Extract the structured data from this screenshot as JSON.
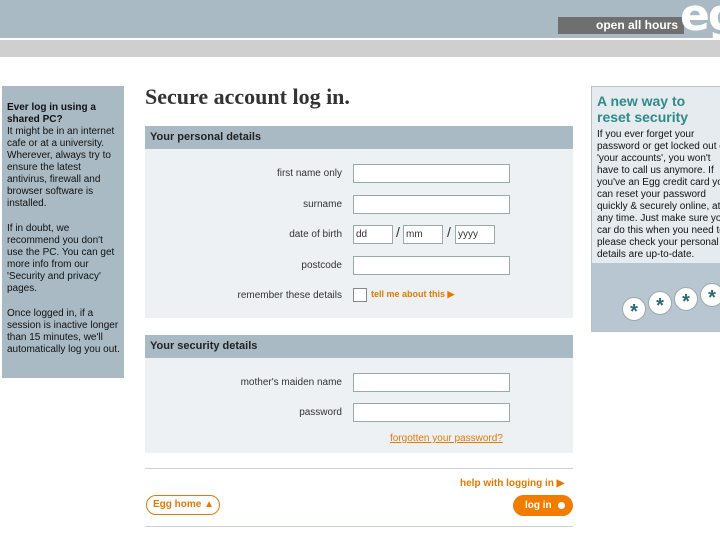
{
  "header": {
    "hours_label": "open all hours",
    "brand": "eg"
  },
  "sidebar_info": {
    "heading": "Ever log in using a shared PC?",
    "p1": "It might be in an internet cafe or at a university. Wherever, always try to ensure the latest antivirus, firewall and browser software is installed.",
    "p2": "If in doubt, we recommend you don't use the PC. You can get more info from our 'Security and privacy' pages.",
    "p3": "Once logged in, if a session is inactive longer than 15 minutes, we'll automatically log you out."
  },
  "page_title": "Secure account log in.",
  "personal": {
    "heading": "Your personal details",
    "first_name_label": "first name only",
    "surname_label": "surname",
    "dob_label": "date of birth",
    "dob_dd": "dd",
    "dob_mm": "mm",
    "dob_yyyy": "yyyy",
    "dob_sep": "/",
    "postcode_label": "postcode",
    "remember_label": "remember these details",
    "tell_me": "tell me about this ▶"
  },
  "security": {
    "heading": "Your security details",
    "maiden_label": "mother's maiden name",
    "password_label": "password",
    "forgot_link": "forgotten your password?"
  },
  "footer": {
    "help_link": "help with logging in ▶",
    "home_button": "Egg home ▲",
    "login_button": "log in"
  },
  "promo": {
    "title_line1": "A new way to",
    "title_line2": "reset security",
    "text": "If you ever forget your password or get locked out of 'your accounts', you won't have to call us anymore. If you've an Egg credit card you can reset your password quickly & securely online, at any time. Just make sure you car do this when you need to, please check your personal details are up-to-date.",
    "stars": [
      "*",
      "*",
      "*",
      "*"
    ]
  },
  "colors": {
    "accent": "#f07d00",
    "panel_head": "#a9bac4",
    "promo_title": "#2f8a8a"
  }
}
